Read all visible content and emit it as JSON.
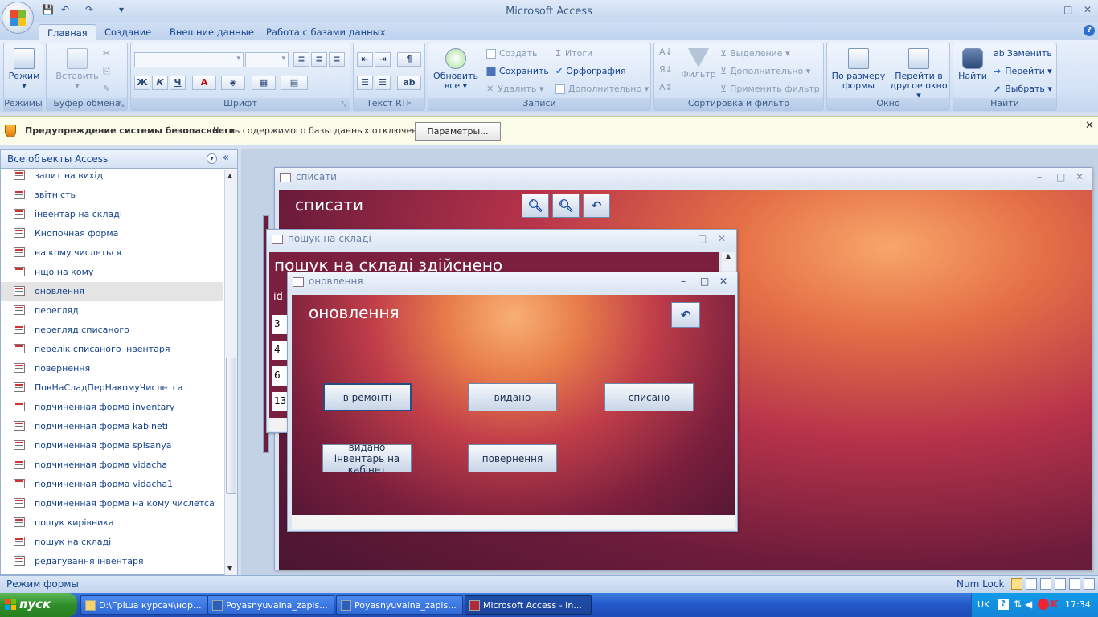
{
  "app": {
    "title": "Microsoft Access",
    "quick_access": {
      "save": "💾",
      "undo": "↶",
      "redo": "↷",
      "customize": "▾"
    }
  },
  "window_controls": {
    "minimize": "–",
    "maximize": "□",
    "close": "✕",
    "help": "?"
  },
  "ribbon": {
    "tabs": [
      "Главная",
      "Создание",
      "Внешние данные",
      "Работа с базами данных"
    ],
    "groups": {
      "views": {
        "label": "Режимы",
        "mode_button": "Режим"
      },
      "clipboard": {
        "label": "Буфер обмена",
        "paste_button": "Вставить"
      },
      "font": {
        "label": "Шрифт",
        "bold": "Ж",
        "italic": "К",
        "underline": "Ч",
        "font_color": "A"
      },
      "rtf": {
        "label": "Текст RTF"
      },
      "records": {
        "label": "Записи",
        "refresh_button": "Обновить все",
        "create": "Создать",
        "save": "Сохранить",
        "delete": "Удалить",
        "totals": "Итоги",
        "spelling": "Орфография",
        "more": "Дополнительно"
      },
      "sort_filter": {
        "label": "Сортировка и фильтр",
        "filter_button": "Фильтр",
        "selection": "Выделение",
        "advanced": "Дополнительно",
        "apply_filter": "Применить фильтр"
      },
      "window": {
        "label": "Окно",
        "fit_form": "По размеру формы",
        "switch_window": "Перейти в другое окно"
      },
      "find": {
        "label": "Найти",
        "find_button": "Найти",
        "replace": "Заменить",
        "goto": "Перейти",
        "select": "Выбрать"
      }
    }
  },
  "security_bar": {
    "title": "Предупреждение системы безопасности",
    "message": "Часть содержимого базы данных отключено",
    "options_button": "Параметры..."
  },
  "nav_pane": {
    "header": "Все объекты Access",
    "items": [
      "запит на вихід",
      "звітність",
      "інвентар на складі",
      "Кнопочная форма",
      "на кому числеться",
      "нщо на кому",
      "оновлення",
      "перегляд",
      "перегляд списаного",
      "перелік списаного інвентаря",
      "повернення",
      "ПовНаСладПерНакомуЧислетса",
      "подчиненная форма inventary",
      "подчиненная форма kabineti",
      "подчиненная форма spisanya",
      "подчиненная форма vidacha",
      "подчиненная форма vidacha1",
      "подчиненная форма на кому числетса",
      "пошук кирівника",
      "пошук на складі",
      "редагування інвентаря"
    ],
    "selected_item": "оновлення"
  },
  "windows": {
    "spysaty": {
      "title": "списати",
      "heading": "списати"
    },
    "poshuk": {
      "title": "пошук на складі",
      "heading": "пошук на складі здійснено",
      "column_id": "id",
      "ids": [
        "3",
        "4",
        "6",
        "13"
      ]
    },
    "onovlennya": {
      "title": "оновлення",
      "heading": "оновлення",
      "buttons": {
        "repair": "в ремонті",
        "issued": "видано",
        "written_off": "списано",
        "issued_to_cabinet": "видано інвентарь на кабінет",
        "returned": "повернення"
      }
    }
  },
  "status_bar": {
    "mode": "Режим формы",
    "numlock": "Num Lock"
  },
  "taskbar": {
    "start": "пуск",
    "items": [
      "D:\\Гріша курсач\\нор...",
      "Poyasnyuvalna_zapis...",
      "Poyasnyuvalna_zapis...",
      "Microsoft Access - In..."
    ],
    "lang": "UK",
    "clock": "17:34"
  },
  "colors": {
    "accent": "#15428b",
    "form_gradient_light": "#f7a66a",
    "form_gradient_dark": "#6d1c3b"
  }
}
